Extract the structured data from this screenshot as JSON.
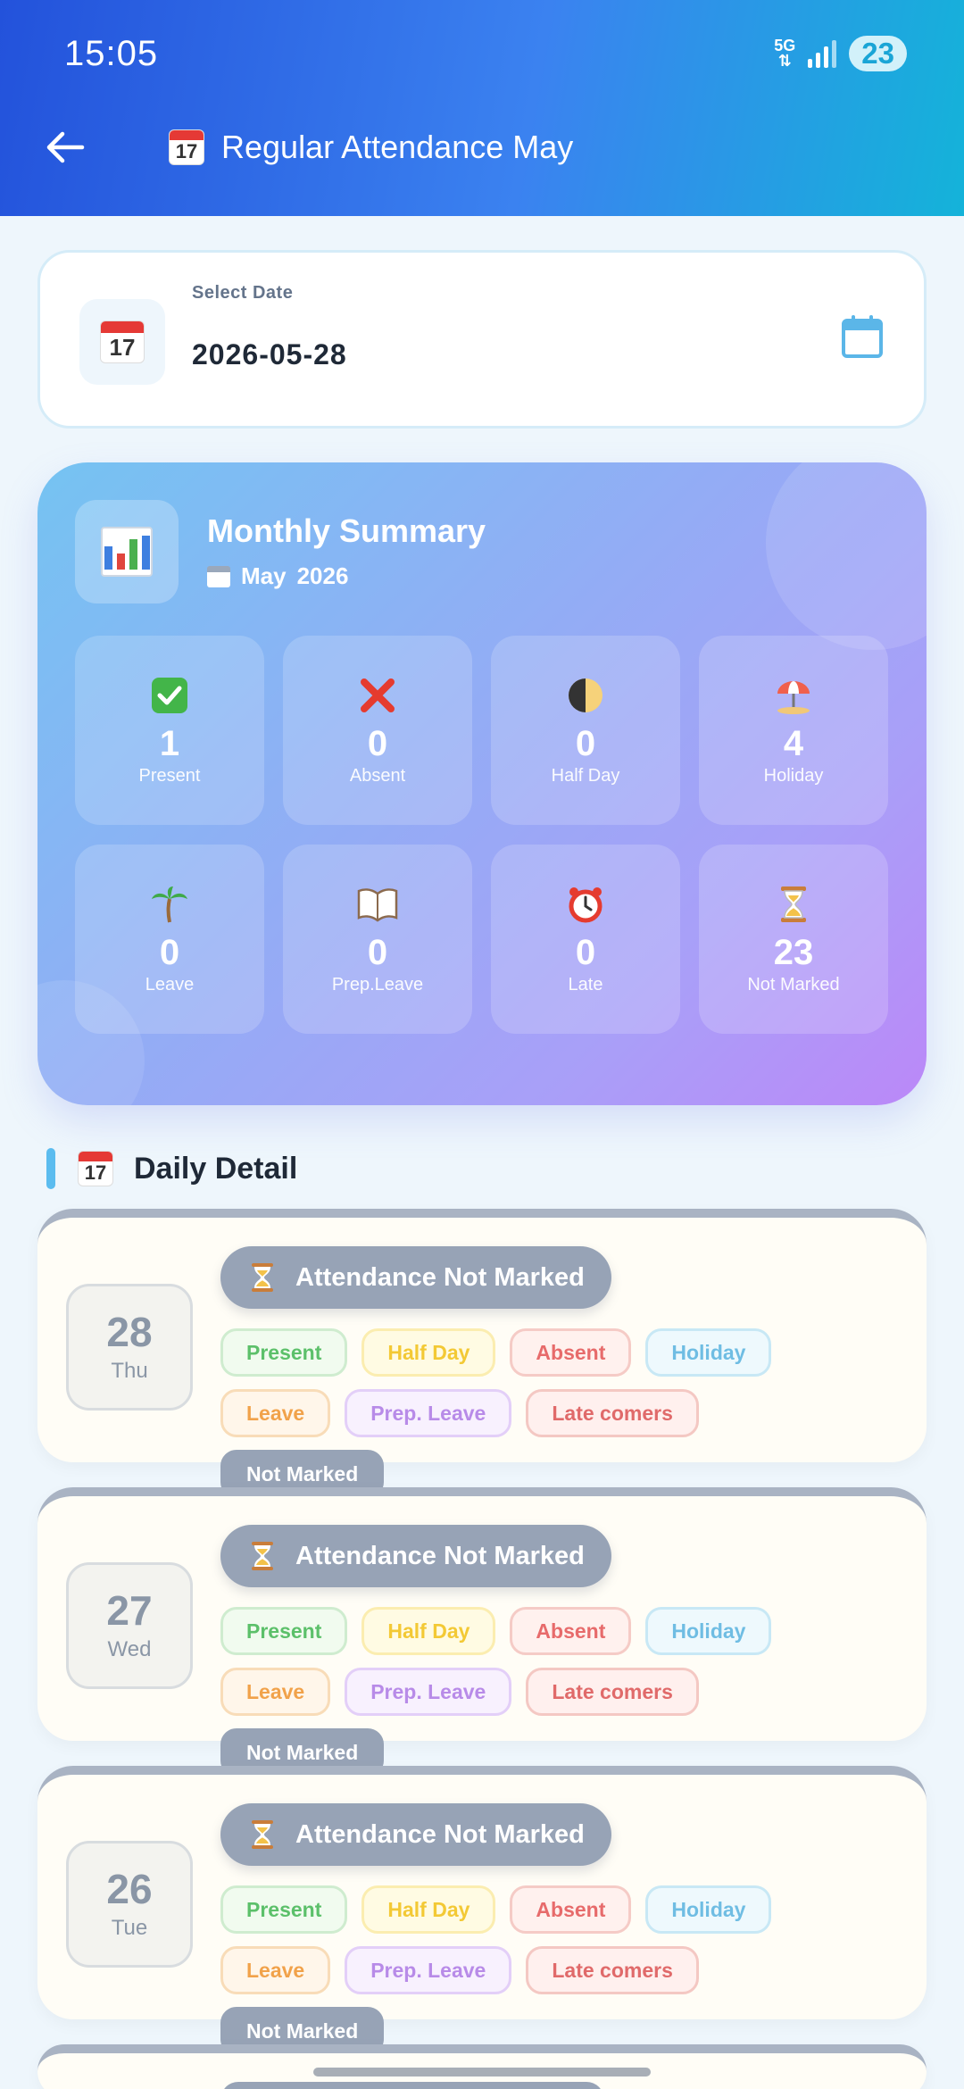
{
  "status_bar": {
    "time": "15:05",
    "network": "5G",
    "battery": "23"
  },
  "header": {
    "title": "Regular Attendance May",
    "icon": "calendar-emoji-icon",
    "calendar_day": "17"
  },
  "date_picker": {
    "label": "Select Date",
    "value": "2026-05-28"
  },
  "summary": {
    "title": "Monthly Summary",
    "month": "May",
    "year": "2026",
    "stats": [
      {
        "icon": "check-icon",
        "value": "1",
        "label": "Present"
      },
      {
        "icon": "cross-icon",
        "value": "0",
        "label": "Absent"
      },
      {
        "icon": "half-moon-icon",
        "value": "0",
        "label": "Half Day"
      },
      {
        "icon": "beach-umbrella-icon",
        "value": "4",
        "label": "Holiday"
      },
      {
        "icon": "palm-tree-icon",
        "value": "0",
        "label": "Leave"
      },
      {
        "icon": "book-icon",
        "value": "0",
        "label": "Prep.Leave"
      },
      {
        "icon": "alarm-clock-icon",
        "value": "0",
        "label": "Late"
      },
      {
        "icon": "hourglass-icon",
        "value": "23",
        "label": "Not Marked"
      }
    ]
  },
  "daily_detail": {
    "title": "Daily Detail",
    "options": [
      "Present",
      "Half Day",
      "Absent",
      "Holiday",
      "Leave",
      "Prep. Leave",
      "Late comers",
      "Not Marked"
    ],
    "days": [
      {
        "day": "28",
        "weekday": "Thu",
        "status": "Attendance Not Marked"
      },
      {
        "day": "27",
        "weekday": "Wed",
        "status": "Attendance Not Marked"
      },
      {
        "day": "26",
        "weekday": "Tue",
        "status": "Attendance Not Marked"
      }
    ]
  },
  "colors": {
    "header_start": "#2352db",
    "header_end": "#14b3d9",
    "not_marked": "#97a3b6",
    "accent": "#5bbcef"
  }
}
